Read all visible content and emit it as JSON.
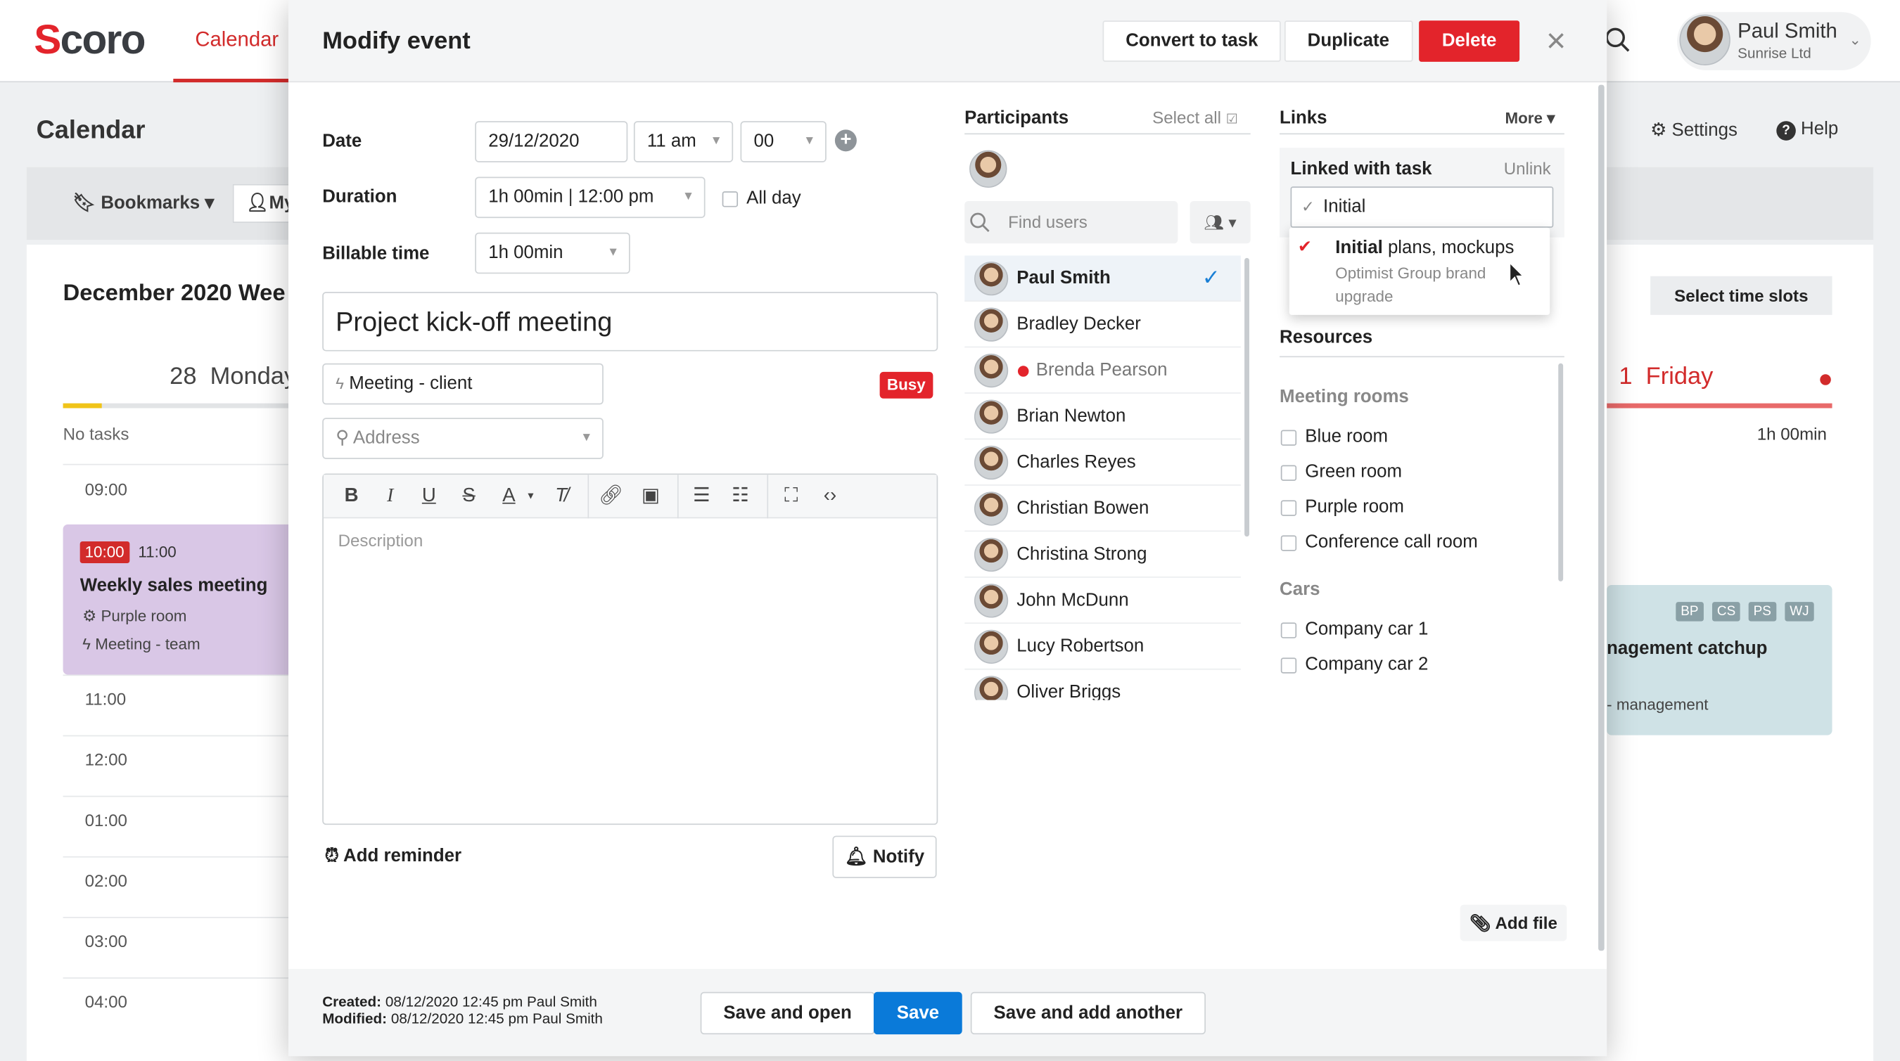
{
  "app": {
    "logo": "Scoro",
    "nav_calendar": "Calendar",
    "page_title": "Calendar",
    "settings": "Settings",
    "help": "Help",
    "user": {
      "name": "Paul Smith",
      "org": "Sunrise Ltd"
    },
    "toolbar": {
      "bookmarks": "Bookmarks",
      "my": "My"
    },
    "month_title": "December 2020 Wee",
    "select_time_slots": "Select time slots",
    "day_monday": "28  Monday",
    "day_friday": "1  Friday",
    "no_tasks": "No tasks",
    "friday_duration": "1h 00min",
    "hours": [
      "09:00",
      "11:00",
      "12:00",
      "01:00",
      "02:00",
      "03:00",
      "04:00"
    ],
    "event_sales": {
      "start": "10:00",
      "end": "11:00",
      "title": "Weekly sales meeting",
      "room": "Purple room",
      "type": "Meeting - team"
    },
    "event_mgmt": {
      "tags": [
        "BP",
        "CS",
        "PS",
        "WJ"
      ],
      "title": "nagement catchup",
      "type": "- management"
    }
  },
  "modal": {
    "title": "Modify event",
    "buttons": {
      "convert": "Convert to task",
      "duplicate": "Duplicate",
      "delete": "Delete"
    },
    "labels": {
      "date": "Date",
      "duration": "Duration",
      "billable": "Billable time",
      "all_day": "All day"
    },
    "date_value": "29/12/2020",
    "hour_value": "11 am",
    "minute_value": "00",
    "duration_value": "1h 00min",
    "end_time_value": "12:00 pm",
    "billable_value": "1h 00min",
    "event_title": "Project kick-off meeting",
    "event_type": "Meeting - client",
    "status_badge": "Busy",
    "address_placeholder": "Address",
    "description_placeholder": "Description",
    "add_reminder": "Add reminder",
    "notify": "Notify",
    "created_label": "Created:",
    "created_value": "08/12/2020 12:45 pm Paul Smith",
    "modified_label": "Modified:",
    "modified_value": "08/12/2020 12:45 pm Paul Smith",
    "footer_buttons": {
      "save_open": "Save and open",
      "save": "Save",
      "save_add": "Save and add another"
    }
  },
  "participants": {
    "heading": "Participants",
    "select_all": "Select all",
    "find_placeholder": "Find users",
    "list": [
      {
        "name": "Paul Smith",
        "selected": true
      },
      {
        "name": "Bradley Decker"
      },
      {
        "name": "Brenda Pearson",
        "busy": true
      },
      {
        "name": "Brian Newton"
      },
      {
        "name": "Charles Reyes"
      },
      {
        "name": "Christian Bowen"
      },
      {
        "name": "Christina Strong"
      },
      {
        "name": "John McDunn"
      },
      {
        "name": "Lucy Robertson"
      },
      {
        "name": "Oliver Briggs"
      }
    ]
  },
  "links": {
    "heading": "Links",
    "more": "More",
    "linked_with_task": "Linked with task",
    "unlink": "Unlink",
    "search_value": "Initial",
    "option": {
      "match": "Initial",
      "rest": " plans, mockups",
      "project": "Optimist Group brand upgrade"
    }
  },
  "resources": {
    "heading": "Resources",
    "meeting_rooms_heading": "Meeting rooms",
    "rooms": [
      "Blue room",
      "Green room",
      "Purple room",
      "Conference call room"
    ],
    "cars_heading": "Cars",
    "cars": [
      "Company car 1",
      "Company car 2"
    ],
    "add_file": "Add file"
  },
  "colors": {
    "brand_red": "#e3242b",
    "primary_blue": "#0a7ad9",
    "event_purple": "#d9c7e6"
  }
}
